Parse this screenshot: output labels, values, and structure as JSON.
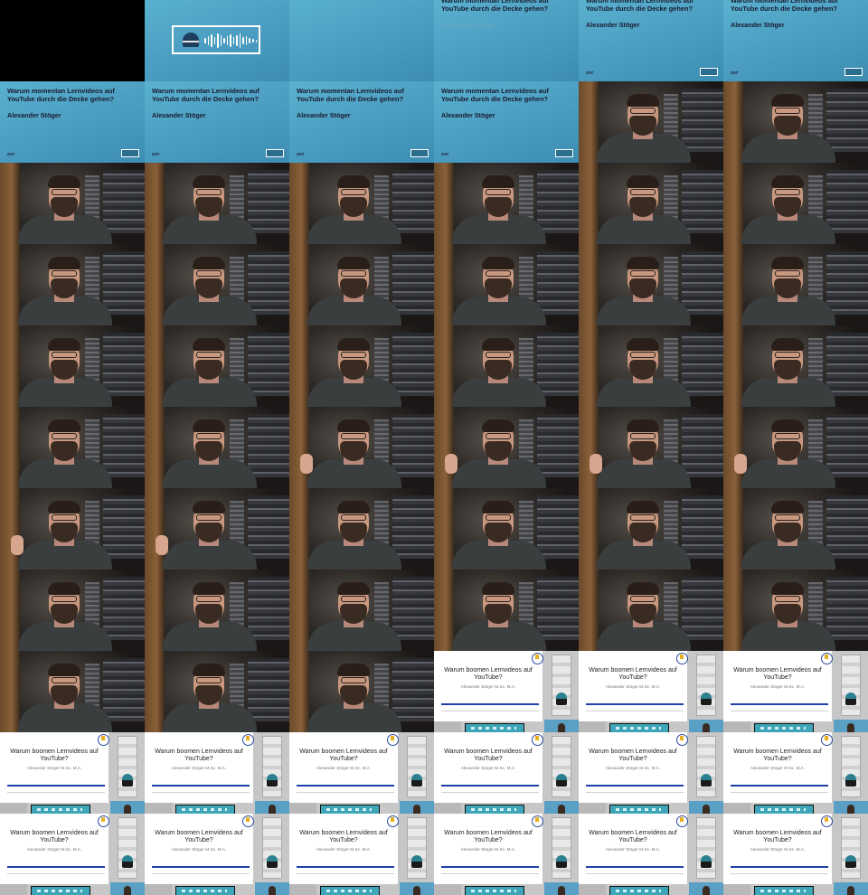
{
  "title_card": {
    "title": "Warum momentan Lernvideos auf YouTube durch die Decke gehen?",
    "author": "Alexander Stöger",
    "small_label": "ZAT"
  },
  "slide": {
    "title": "Warum boomen Lernvideos auf YouTube?",
    "author": "Alexander Stöger M.Sc. M.A."
  },
  "frames": [
    {
      "type": "black"
    },
    {
      "type": "logo"
    },
    {
      "type": "blue-empty"
    },
    {
      "type": "title-offset-faint"
    },
    {
      "type": "title-offset"
    },
    {
      "type": "title-offset"
    },
    {
      "type": "title"
    },
    {
      "type": "title"
    },
    {
      "type": "title"
    },
    {
      "type": "title"
    },
    {
      "type": "cam"
    },
    {
      "type": "cam"
    },
    {
      "type": "cam"
    },
    {
      "type": "cam"
    },
    {
      "type": "cam"
    },
    {
      "type": "cam"
    },
    {
      "type": "cam"
    },
    {
      "type": "cam"
    },
    {
      "type": "cam"
    },
    {
      "type": "cam"
    },
    {
      "type": "cam"
    },
    {
      "type": "cam"
    },
    {
      "type": "cam"
    },
    {
      "type": "cam"
    },
    {
      "type": "cam"
    },
    {
      "type": "cam"
    },
    {
      "type": "cam"
    },
    {
      "type": "cam"
    },
    {
      "type": "cam"
    },
    {
      "type": "cam"
    },
    {
      "type": "cam"
    },
    {
      "type": "cam"
    },
    {
      "type": "cam-thumb"
    },
    {
      "type": "cam-thumb"
    },
    {
      "type": "cam-thumb"
    },
    {
      "type": "cam-thumb"
    },
    {
      "type": "cam-thumb"
    },
    {
      "type": "cam-thumb"
    },
    {
      "type": "cam"
    },
    {
      "type": "cam"
    },
    {
      "type": "cam"
    },
    {
      "type": "cam"
    },
    {
      "type": "cam"
    },
    {
      "type": "cam"
    },
    {
      "type": "cam"
    },
    {
      "type": "cam"
    },
    {
      "type": "cam"
    },
    {
      "type": "cam"
    },
    {
      "type": "cam"
    },
    {
      "type": "cam"
    },
    {
      "type": "cam"
    },
    {
      "type": "slide"
    },
    {
      "type": "slide"
    },
    {
      "type": "slide"
    },
    {
      "type": "slide"
    },
    {
      "type": "slide"
    },
    {
      "type": "slide"
    },
    {
      "type": "slide"
    },
    {
      "type": "slide"
    },
    {
      "type": "slide"
    },
    {
      "type": "slide"
    },
    {
      "type": "slide"
    },
    {
      "type": "slide"
    },
    {
      "type": "slide"
    },
    {
      "type": "slide"
    },
    {
      "type": "slide"
    }
  ]
}
